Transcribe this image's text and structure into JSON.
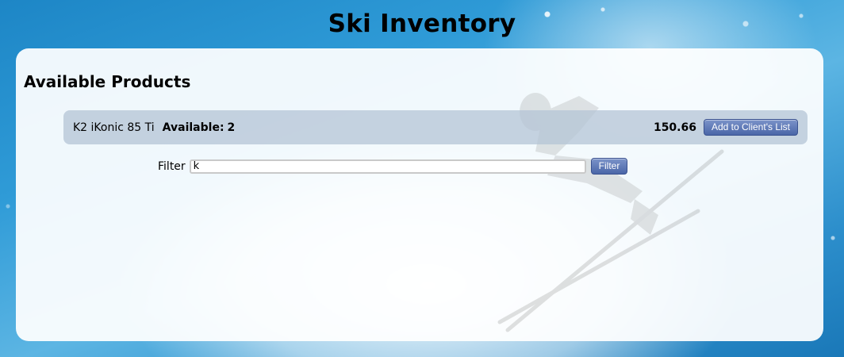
{
  "header": {
    "title": "Ski Inventory"
  },
  "panel": {
    "section_title": "Available Products",
    "products": [
      {
        "name": "K2 iKonic 85 Ti",
        "available_label": "Available:",
        "available_count": "2",
        "price": "150.66",
        "add_button_label": "Add to Client's List"
      }
    ],
    "filter": {
      "label": "Filter",
      "value": "k",
      "button_label": "Filter"
    }
  },
  "colors": {
    "button": "#5a74b4",
    "product_row": "#b4c4d6",
    "background": "#2f9bd7"
  },
  "icons": {
    "background_image": "skier-illustration"
  }
}
